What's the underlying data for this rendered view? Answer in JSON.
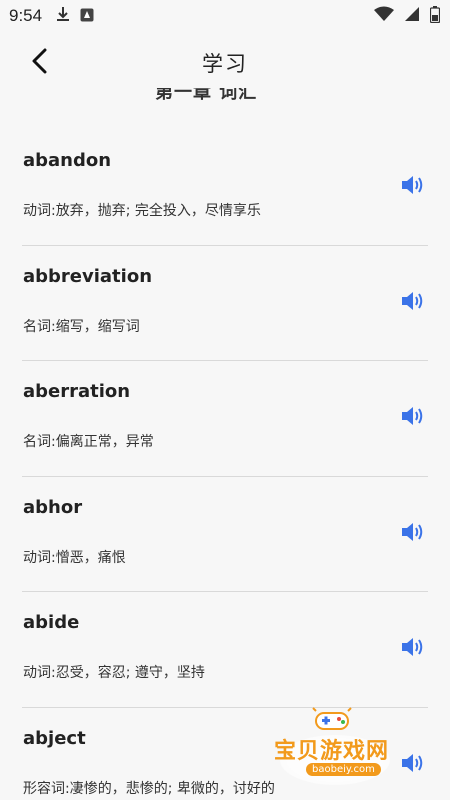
{
  "status_bar": {
    "time": "9:54",
    "icons_left": [
      "download-icon",
      "app-notification-icon"
    ],
    "icons_right": [
      "wifi-icon",
      "signal-icon",
      "battery-icon"
    ]
  },
  "header": {
    "title": "学习",
    "back_icon": "chevron-left-icon",
    "clipped_heading": "第一章 词汇"
  },
  "words": [
    {
      "term": "abandon",
      "definition": "动词:放弃，抛弃; 完全投入，尽情享乐"
    },
    {
      "term": "abbreviation",
      "definition": "名词:缩写，缩写词"
    },
    {
      "term": "aberration",
      "definition": "名词:偏离正常，异常"
    },
    {
      "term": "abhor",
      "definition": "动词:憎恶，痛恨"
    },
    {
      "term": "abide",
      "definition": "动词:忍受，容忍; 遵守，坚持"
    },
    {
      "term": "abject",
      "definition": "形容词:凄惨的，悲惨的; 卑微的，讨好的"
    }
  ],
  "colors": {
    "speaker": "#3b73e8",
    "background": "#f7f7f7",
    "divider": "#d9d9d9",
    "watermark": "#f29a1c"
  },
  "watermark": {
    "title": "宝贝游戏网",
    "url": "baobeiy.com"
  }
}
